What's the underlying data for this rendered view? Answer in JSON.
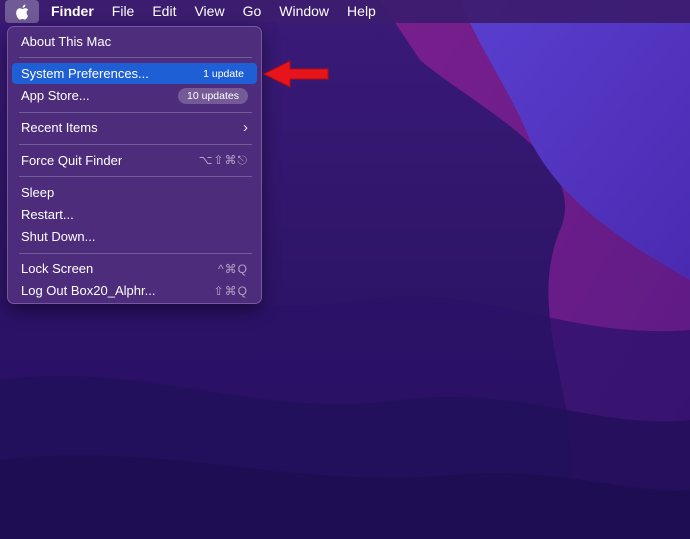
{
  "menubar": {
    "items": [
      {
        "label": "Finder",
        "bold": true
      },
      {
        "label": "File"
      },
      {
        "label": "Edit"
      },
      {
        "label": "View"
      },
      {
        "label": "Go"
      },
      {
        "label": "Window"
      },
      {
        "label": "Help"
      }
    ],
    "apple_icon": "apple-icon"
  },
  "apple_menu": {
    "about": "About This Mac",
    "system_preferences": "System Preferences...",
    "system_preferences_badge": "1 update",
    "app_store": "App Store...",
    "app_store_badge": "10 updates",
    "recent_items": "Recent Items",
    "recent_items_icon": "chevron-right-icon",
    "force_quit": "Force Quit Finder",
    "force_quit_shortcut": "⌥⇧⌘⎋",
    "sleep": "Sleep",
    "restart": "Restart...",
    "shut_down": "Shut Down...",
    "lock_screen": "Lock Screen",
    "lock_screen_shortcut": "^⌘Q",
    "log_out": "Log Out Box20_Alphr...",
    "log_out_shortcut": "⇧⌘Q"
  },
  "colors": {
    "highlight": "#1f5fd6",
    "arrow": "#e8141b",
    "menu_background": "#4e2e7c"
  },
  "annotation": {
    "icon": "red-arrow-icon"
  }
}
